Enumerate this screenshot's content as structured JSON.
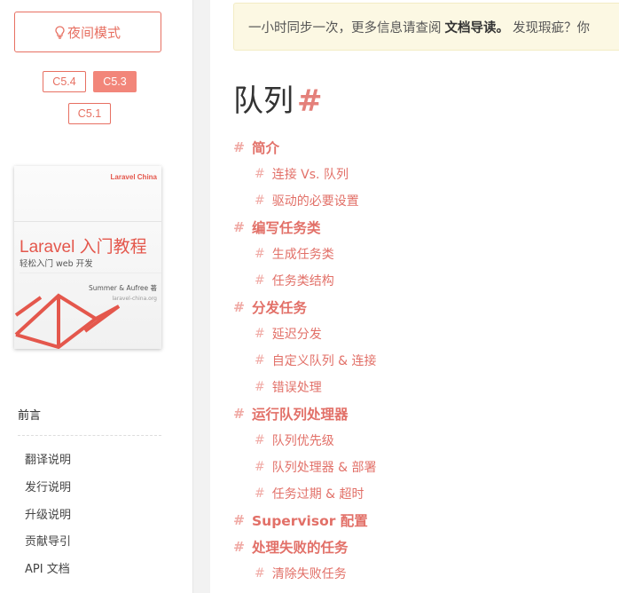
{
  "sidebar": {
    "night_mode_label": "夜间模式",
    "versions": [
      {
        "label": "C5.4",
        "active": false
      },
      {
        "label": "C5.3",
        "active": true
      },
      {
        "label": "C5.1",
        "active": false
      }
    ],
    "book": {
      "brand": "Laravel China",
      "title": "Laravel 入门教程",
      "subtitle": "轻松入门 web 开发",
      "author": "Summer & Aufree 著",
      "site": "laravel-china.org"
    },
    "nav_heading": "前言",
    "nav_items": [
      "翻译说明",
      "发行说明",
      "升级说明",
      "贡献导引",
      "API 文档"
    ]
  },
  "main": {
    "notice": {
      "before": "一小时同步一次，更多信息请查阅",
      "link": "文档导读。",
      "after": "发现瑕疵？你"
    },
    "title": "队列",
    "anchor": "#",
    "toc": [
      {
        "hash": "#",
        "text": "简介"
      },
      {
        "hash": "#",
        "text": "连接 Vs. 队列"
      },
      {
        "hash": "#",
        "text": "驱动的必要设置"
      },
      {
        "hash": "#",
        "text": "编写任务类"
      },
      {
        "hash": "#",
        "text": "生成任务类"
      },
      {
        "hash": "#",
        "text": "任务类结构"
      },
      {
        "hash": "#",
        "text": "分发任务"
      },
      {
        "hash": "#",
        "text": "延迟分发"
      },
      {
        "hash": "#",
        "text": "自定义队列 & 连接"
      },
      {
        "hash": "#",
        "text": "错误处理"
      },
      {
        "hash": "#",
        "text": "运行队列处理器"
      },
      {
        "hash": "#",
        "text": "队列优先级"
      },
      {
        "hash": "#",
        "text": "队列处理器 & 部署"
      },
      {
        "hash": "#",
        "text": "任务过期 & 超时"
      },
      {
        "hash": "#",
        "text": "Supervisor 配置"
      },
      {
        "hash": "#",
        "text": "处理失败的任务"
      },
      {
        "hash": "#",
        "text": "清除失败任务"
      }
    ]
  },
  "colors": {
    "accent": "#e77062",
    "active_version_bg": "#f2867a",
    "notice_bg": "#fcf8e3",
    "toc_text": "#e27068",
    "toc_hash": "#f0aaa5"
  }
}
